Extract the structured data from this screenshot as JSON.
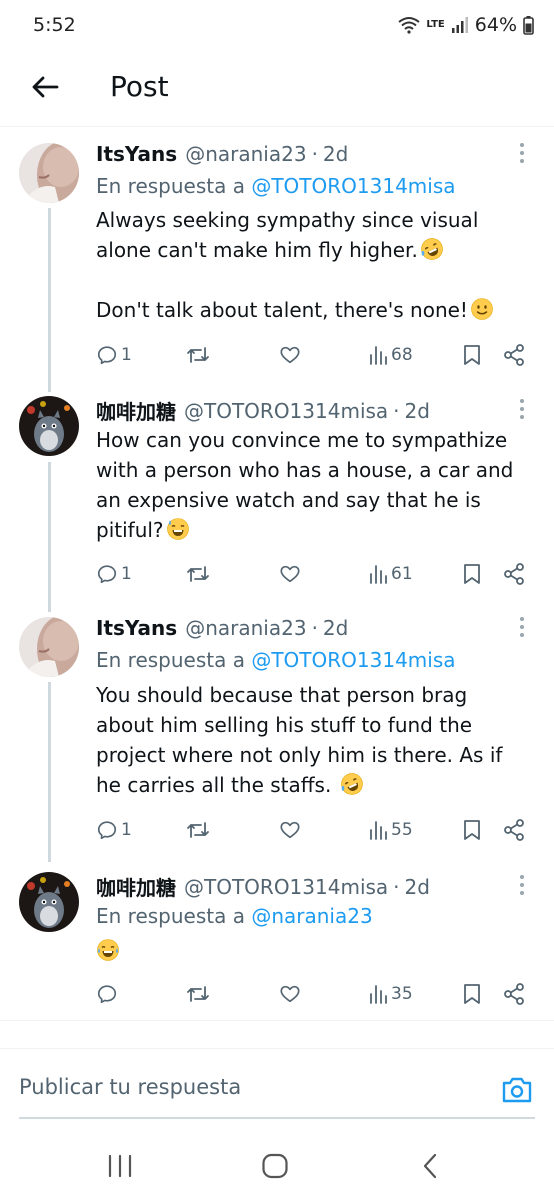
{
  "status_bar": {
    "time": "5:52",
    "network": "LTE",
    "battery": "64%"
  },
  "app_bar": {
    "title": "Post"
  },
  "tweets": [
    {
      "name": "ItsYans",
      "handle": "@narania23",
      "dot": "·",
      "time": "2d",
      "reply_prefix": "En respuesta a ",
      "reply_to": "@TOTORO1314misa",
      "text": [
        "Always seeking sympathy since visual alone can't make him fly higher.",
        "Don't talk about talent, there's none!"
      ],
      "emoji": [
        "rolling-on-floor-laughing",
        "slightly-smiling"
      ],
      "replies": "1",
      "retweets": "",
      "likes": "",
      "views": "68"
    },
    {
      "name": "咖啡加糖",
      "handle": "@TOTORO1314misa",
      "dot": "·",
      "time": "2d",
      "text": [
        "How can you convince me to sympathize with a person who has a house, a car and an expensive watch and say that he is pitiful?"
      ],
      "emoji": [
        "grinning-sweat"
      ],
      "replies": "1",
      "retweets": "",
      "likes": "",
      "views": "61"
    },
    {
      "name": "ItsYans",
      "handle": "@narania23",
      "dot": "·",
      "time": "2d",
      "reply_prefix": "En respuesta a ",
      "reply_to": "@TOTORO1314misa",
      "text": [
        "You should because that person brag about him selling his stuff to fund the project where not only him is there. As if he carries all the staffs."
      ],
      "emoji": [
        "rolling-on-floor-laughing"
      ],
      "replies": "1",
      "retweets": "",
      "likes": "",
      "views": "55"
    },
    {
      "name": "咖啡加糖",
      "handle": "@TOTORO1314misa",
      "dot": "·",
      "time": "2d",
      "reply_prefix": "En respuesta a ",
      "reply_to": "@narania23",
      "text": [],
      "emoji": [
        "tears-of-joy"
      ],
      "replies": "",
      "retweets": "",
      "likes": "",
      "views": "35"
    }
  ],
  "composer": {
    "placeholder": "Publicar tu respuesta"
  },
  "colors": {
    "link": "#1d9bf0",
    "text": "#0f1419",
    "muted": "#536471",
    "thread_line": "#cfd9de"
  },
  "icons": [
    "back-arrow-icon",
    "more-icon",
    "reply-icon",
    "retweet-icon",
    "like-icon",
    "views-icon",
    "bookmark-icon",
    "share-icon",
    "camera-icon",
    "recents-icon",
    "home-icon",
    "back-nav-icon"
  ]
}
